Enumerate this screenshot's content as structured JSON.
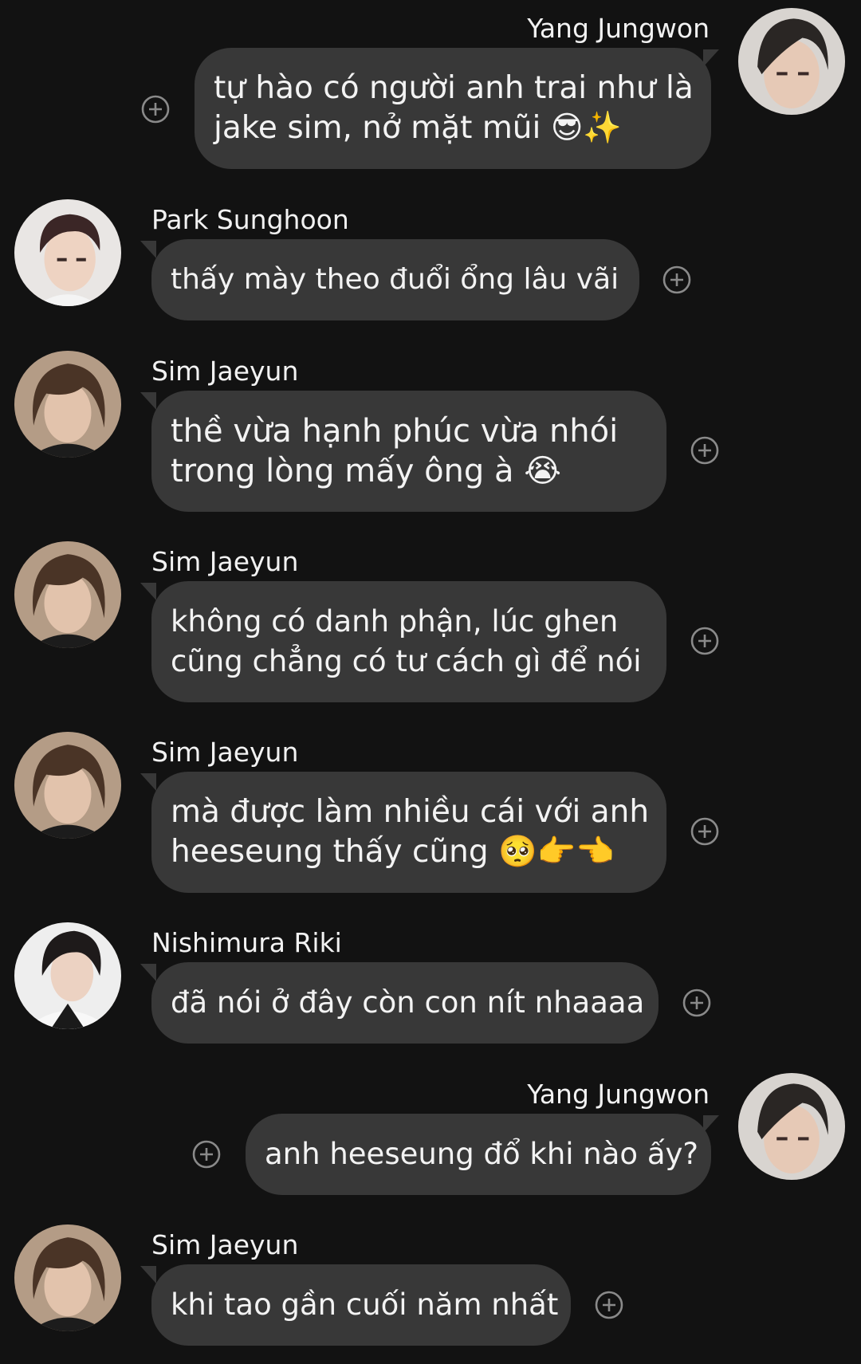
{
  "messages": [
    {
      "id": "m1",
      "side": "right",
      "sender": "Yang Jungwon",
      "avatar": "avatar-yang-jungwon",
      "lines": [
        "tự hào có người anh trai như là",
        "jake sim, nở mặt mũi 😎✨"
      ]
    },
    {
      "id": "m2",
      "side": "left",
      "sender": "Park Sunghoon",
      "avatar": "avatar-park-sunghoon",
      "lines": [
        "thấy mày theo đuổi ổng lâu vãi"
      ]
    },
    {
      "id": "m3",
      "side": "left",
      "sender": "Sim Jaeyun",
      "avatar": "avatar-sim-jaeyun",
      "lines": [
        "thề vừa hạnh phúc vừa nhói",
        "trong lòng mấy ông à 😭"
      ]
    },
    {
      "id": "m4",
      "side": "left",
      "sender": "Sim Jaeyun",
      "avatar": "avatar-sim-jaeyun",
      "lines": [
        "không có danh phận, lúc ghen",
        "cũng chẳng có tư cách gì để nói"
      ]
    },
    {
      "id": "m5",
      "side": "left",
      "sender": "Sim Jaeyun",
      "avatar": "avatar-sim-jaeyun",
      "lines": [
        "mà được làm nhiều cái với anh",
        "heeseung thấy cũng 🥺👉👈"
      ]
    },
    {
      "id": "m6",
      "side": "left",
      "sender": "Nishimura Riki",
      "avatar": "avatar-nishimura-riki",
      "lines": [
        "đã nói ở đây còn con nít nhaaaa"
      ]
    },
    {
      "id": "m7",
      "side": "right",
      "sender": "Yang Jungwon",
      "avatar": "avatar-yang-jungwon",
      "lines": [
        "anh heeseung đổ khi nào ấy?"
      ]
    },
    {
      "id": "m8",
      "side": "left",
      "sender": "Sim Jaeyun",
      "avatar": "avatar-sim-jaeyun",
      "lines": [
        "khi tao gần cuối năm nhất"
      ]
    }
  ],
  "icons": {
    "react": "add-reaction-icon"
  },
  "colors": {
    "background": "#121212",
    "bubble": "#383838",
    "text": "#f3f3f3",
    "icon": "#8a8a8a"
  }
}
